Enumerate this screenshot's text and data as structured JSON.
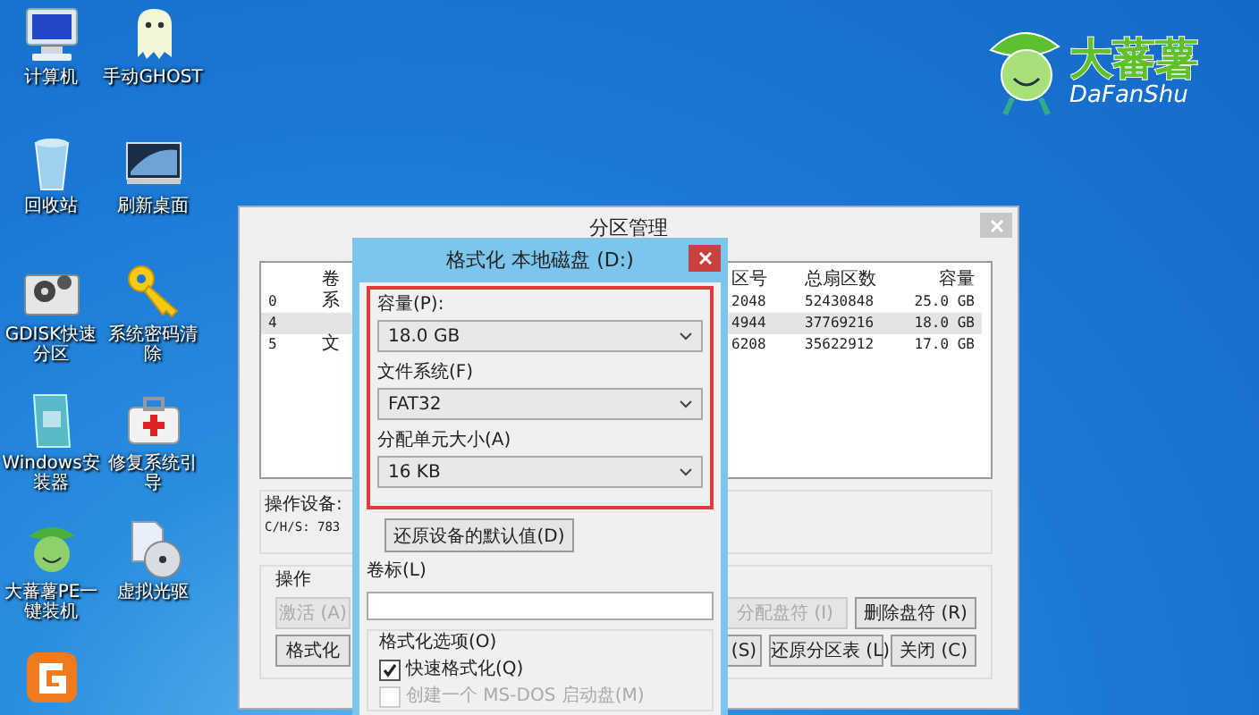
{
  "desktop_icons": [
    {
      "kind": "computer",
      "label": "计算机"
    },
    {
      "kind": "ghost",
      "label": "手动GHOST"
    },
    {
      "kind": "recycle",
      "label": "回收站"
    },
    {
      "kind": "display",
      "label": "刷新桌面"
    },
    {
      "kind": "gear-disk",
      "label": "GDISK快速分区"
    },
    {
      "kind": "key",
      "label": "系统密码清除"
    },
    {
      "kind": "installer",
      "label": "Windows安装器"
    },
    {
      "kind": "medkit",
      "label": "修复系统引导"
    },
    {
      "kind": "mascot",
      "label": "大蕃薯PE一键装机"
    },
    {
      "kind": "disc",
      "label": "虚拟光驱"
    },
    {
      "kind": "app"
    }
  ],
  "logo": {
    "name": "大蕃薯",
    "latin": "DaFanShu"
  },
  "partition_window": {
    "title": "分区管理",
    "table": {
      "headers": {
        "column_2": "卷",
        "start_sector": "区号",
        "total_sectors": "总扇区数",
        "capacity": "容量"
      },
      "rows": [
        {
          "index": "0",
          "column_2": "系",
          "start_sector": "2048",
          "total_sectors": "52430848",
          "capacity": "25.0 GB",
          "selected": false
        },
        {
          "index": "4",
          "start_sector": "4944",
          "total_sectors": "37769216",
          "capacity": "18.0 GB",
          "selected": true
        },
        {
          "index": "5",
          "column_2": "文",
          "start_sector": "6208",
          "total_sectors": "35622912",
          "capacity": "17.0 GB",
          "selected": false
        }
      ]
    },
    "device": {
      "label": "操作设备:",
      "chs": "C/H/S: 783"
    },
    "operations": {
      "label": "操作",
      "left_buttons": [
        {
          "label": "激活 (A)",
          "disabled": true
        },
        {
          "label": "格式化",
          "disabled": false
        }
      ],
      "right_row_1": [
        {
          "label": "分配盘符 (I)",
          "disabled": true
        },
        {
          "label": "删除盘符 (R)",
          "disabled": false
        }
      ],
      "right_row_2": [
        {
          "label": "(S)",
          "disabled": false
        },
        {
          "label": "还原分区表 (L)",
          "disabled": false
        },
        {
          "label": "关闭 (C)",
          "disabled": false
        }
      ]
    }
  },
  "format_dialog": {
    "title": "格式化 本地磁盘 (D:)",
    "fields": [
      {
        "label": "容量(P):",
        "value": "18.0 GB"
      },
      {
        "label": "文件系统(F)",
        "value": "FAT32"
      },
      {
        "label": "分配单元大小(A)",
        "value": "16 KB"
      }
    ],
    "restore_button": "还原设备的默认值(D)",
    "volume_label": {
      "label": "卷标(L)"
    },
    "options": {
      "title": "格式化选项(O)",
      "items": [
        {
          "label": "快速格式化(Q)",
          "checked": true,
          "disabled": false
        },
        {
          "label": "创建一个 MS-DOS 启动盘(M)",
          "checked": false,
          "disabled": true
        }
      ]
    }
  }
}
